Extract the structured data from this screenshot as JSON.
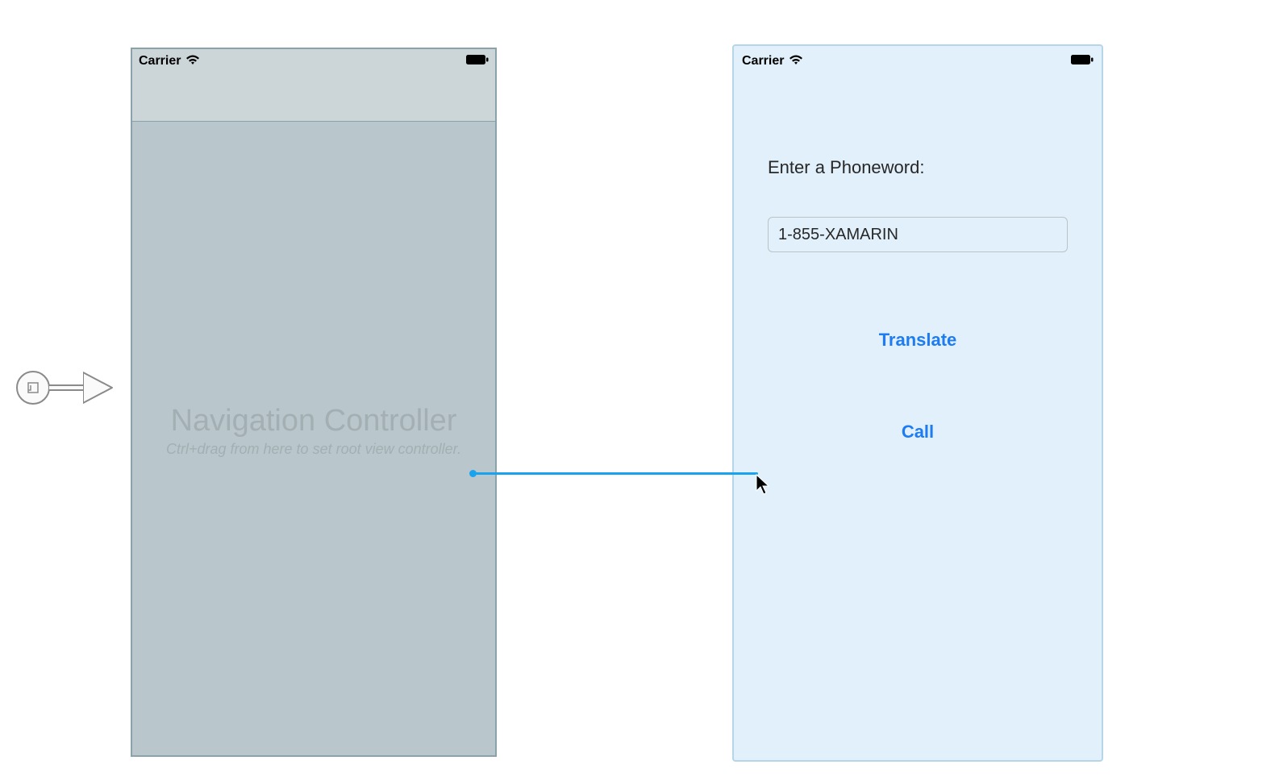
{
  "nav_scene": {
    "statusbar": {
      "carrier": "Carrier"
    },
    "title": "Navigation Controller",
    "subtitle": "Ctrl+drag from here to set root view controller."
  },
  "vc_scene": {
    "statusbar": {
      "carrier": "Carrier"
    },
    "label": "Enter a Phoneword:",
    "textfield_value": "1-855-XAMARIN",
    "translate_button": "Translate",
    "call_button": "Call"
  }
}
